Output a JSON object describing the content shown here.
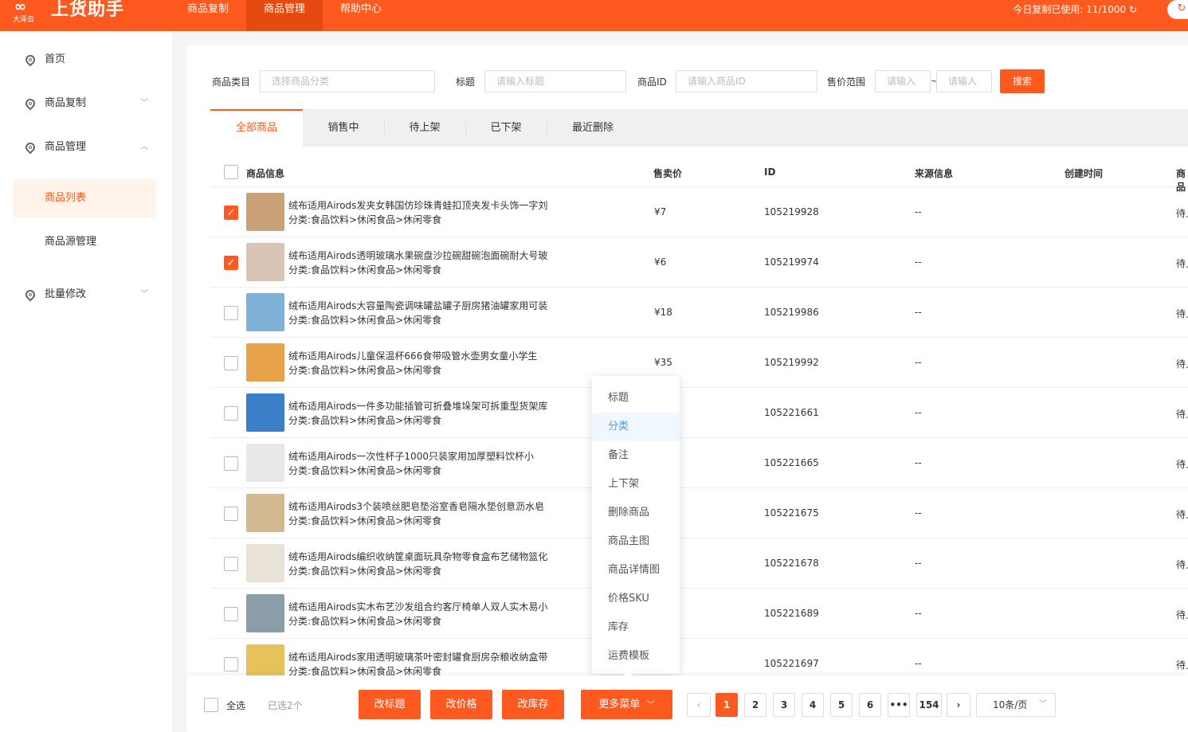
{
  "header": {
    "logo_sub": "大泽云",
    "app_name": "上货助手",
    "nav": [
      "商品复制",
      "商品管理",
      "帮助中心"
    ],
    "active_nav": "商品管理",
    "quota_text": "今日复制已使用: 11/1000",
    "refresh_icon": "↻"
  },
  "sidebar": {
    "home": "首页",
    "copy": "商品复制",
    "manage": "商品管理",
    "product_list": "商品列表",
    "source_manage": "商品源管理",
    "batch_edit": "批量修改"
  },
  "filters": {
    "category_label": "商品类目",
    "category_placeholder": "选择商品分类",
    "title_label": "标题",
    "title_placeholder": "请输入标题",
    "id_label": "商品ID",
    "id_placeholder": "请输入商品ID",
    "price_label": "售价范围",
    "price_min_placeholder": "请输入",
    "price_max_placeholder": "请输入",
    "range_sep": "~",
    "search_button": "搜索"
  },
  "tabs": [
    "全部商品",
    "销售中",
    "待上架",
    "已下架",
    "最近删除"
  ],
  "table": {
    "columns": [
      "商品信息",
      "售卖价",
      "ID",
      "来源信息",
      "创建时间",
      "商品"
    ],
    "rows": [
      {
        "title": "绒布适用Airods发夹女韩国仿珍珠青蛙扣顶夹发卡头饰一字刘",
        "category": "分类:食品饮料>休闲食品>休闲零食",
        "price": "¥7",
        "id": "105219928",
        "source": "--",
        "status": "待上",
        "checked": true
      },
      {
        "title": "绒布适用Airods透明玻璃水果碗盘沙拉碗甜碗泡面碗耐大号玻",
        "category": "分类:食品饮料>休闲食品>休闲零食",
        "price": "¥6",
        "id": "105219974",
        "source": "--",
        "status": "待上",
        "checked": true
      },
      {
        "title": "绒布适用Airods大容量陶瓷调味罐盐罐子厨房猪油罐家用可装",
        "category": "分类:食品饮料>休闲食品>休闲零食",
        "price": "¥18",
        "id": "105219986",
        "source": "--",
        "status": "待上",
        "checked": false
      },
      {
        "title": "绒布适用Airods儿童保温杯666食带吸管水壶男女童小学生",
        "category": "分类:食品饮料>休闲食品>休闲零食",
        "price": "¥35",
        "id": "105219992",
        "source": "--",
        "status": "待上",
        "checked": false
      },
      {
        "title": "绒布适用Airods一件多功能插管可折叠堆垛架可拆重型货架库",
        "category": "分类:食品饮料>休闲食品>休闲零食",
        "price": "",
        "id": "105221661",
        "source": "--",
        "status": "待上",
        "checked": false
      },
      {
        "title": "绒布适用Airods一次性杯子1000只装家用加厚塑料饮杯小",
        "category": "分类:食品饮料>休闲食品>休闲零食",
        "price": "",
        "id": "105221665",
        "source": "--",
        "status": "待上",
        "checked": false
      },
      {
        "title": "绒布适用Airods3个装喷丝肥皂垫浴室香皂隔水垫创意沥水皂",
        "category": "分类:食品饮料>休闲食品>休闲零食",
        "price": "",
        "id": "105221675",
        "source": "--",
        "status": "待上",
        "checked": false
      },
      {
        "title": "绒布适用Airods编织收纳筐桌面玩具杂物零食盒布艺储物篮化",
        "category": "分类:食品饮料>休闲食品>休闲零食",
        "price": "",
        "id": "105221678",
        "source": "--",
        "status": "待上",
        "checked": false
      },
      {
        "title": "绒布适用Airods实木布艺沙发组合约客厅椅单人双人实木易小",
        "category": "分类:食品饮料>休闲食品>休闲零食",
        "price": "",
        "id": "105221689",
        "source": "--",
        "status": "待上",
        "checked": false
      },
      {
        "title": "绒布适用Airods家用透明玻璃茶叶密封罐食厨房杂粮收纳盒带",
        "category": "分类:食品饮料>休闲食品>休闲零食",
        "price": "",
        "id": "105221697",
        "source": "--",
        "status": "待上",
        "checked": false
      }
    ]
  },
  "dropdown": {
    "items": [
      "标题",
      "分类",
      "备注",
      "上下架",
      "删除商品",
      "商品主图",
      "商品详情图",
      "价格SKU",
      "库存",
      "运费模板"
    ],
    "hovered": "分类"
  },
  "bottom": {
    "select_all": "全选",
    "selected_count": "已选2个",
    "edit_title": "改标题",
    "edit_price": "改价格",
    "edit_stock": "改库存",
    "more_menu": "更多菜单",
    "pages": [
      "1",
      "2",
      "3",
      "4",
      "5",
      "6",
      "•••",
      "154"
    ],
    "current_page": "1",
    "prev": "‹",
    "next": "›",
    "page_size": "10条/页"
  },
  "colors": {
    "brand": "#fe5a1f",
    "hover_blue": "#4e9be6"
  },
  "thumb_colors": [
    "#c9a27a",
    "#d9c5b5",
    "#7fb2d6",
    "#e8a34a",
    "#3a7fc8",
    "#e8e8e8",
    "#d2b990",
    "#e9e2d6",
    "#8a9da8",
    "#e6c35a"
  ]
}
